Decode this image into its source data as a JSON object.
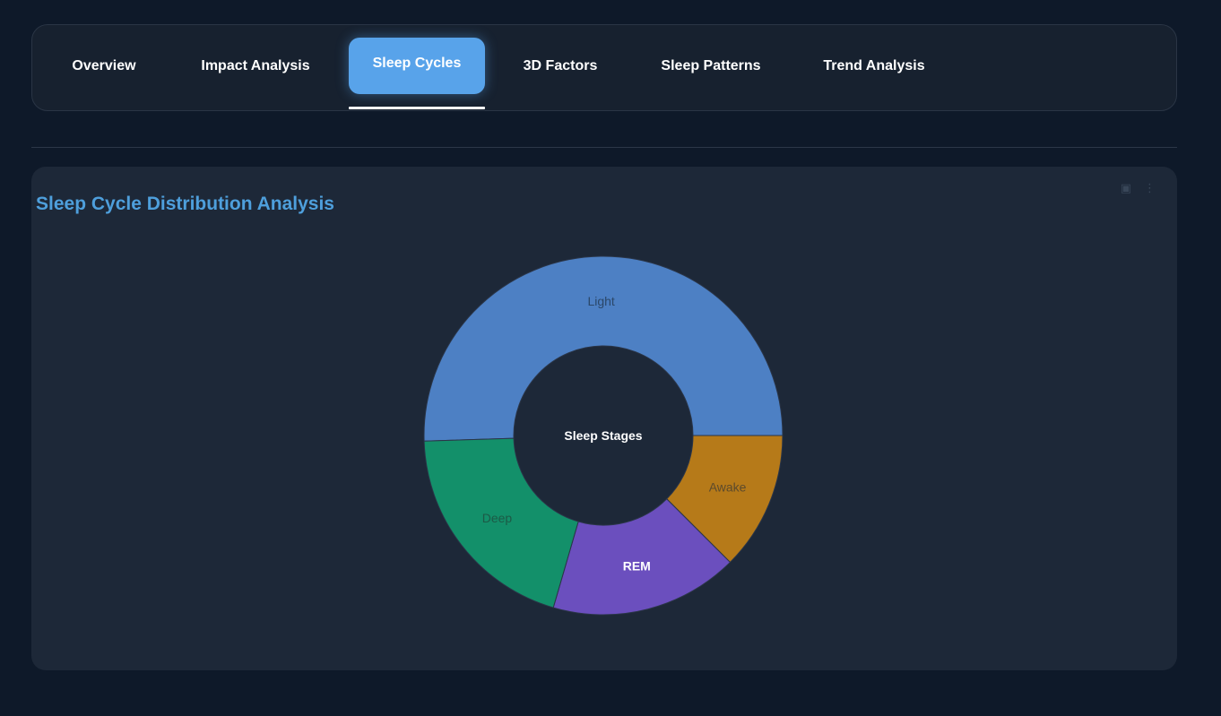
{
  "tabs": [
    {
      "label": "Overview",
      "active": false
    },
    {
      "label": "Impact Analysis",
      "active": false
    },
    {
      "label": "Sleep Cycles",
      "active": true
    },
    {
      "label": "3D Factors",
      "active": false
    },
    {
      "label": "Sleep Patterns",
      "active": false
    },
    {
      "label": "Trend Analysis",
      "active": false
    }
  ],
  "icons": {
    "camera": "camera-icon",
    "more": "more-icon"
  },
  "chart_data": {
    "type": "pie",
    "hole": 0.5,
    "title": "Sleep Cycle Distribution Analysis",
    "center_label": "Sleep Stages",
    "slices": [
      {
        "label": "Light",
        "value": 50.5,
        "color": "#4d80c4",
        "label_color": "#2b4769"
      },
      {
        "label": "Awake",
        "value": 12.5,
        "color": "#b67a19",
        "label_color": "#5c4a2c"
      },
      {
        "label": "REM",
        "value": 17,
        "color": "#6b4fbe",
        "label_color": "#ffffff"
      },
      {
        "label": "Deep",
        "value": 20,
        "color": "#13906a",
        "label_color": "#1c5a46"
      }
    ],
    "legend": "none"
  }
}
